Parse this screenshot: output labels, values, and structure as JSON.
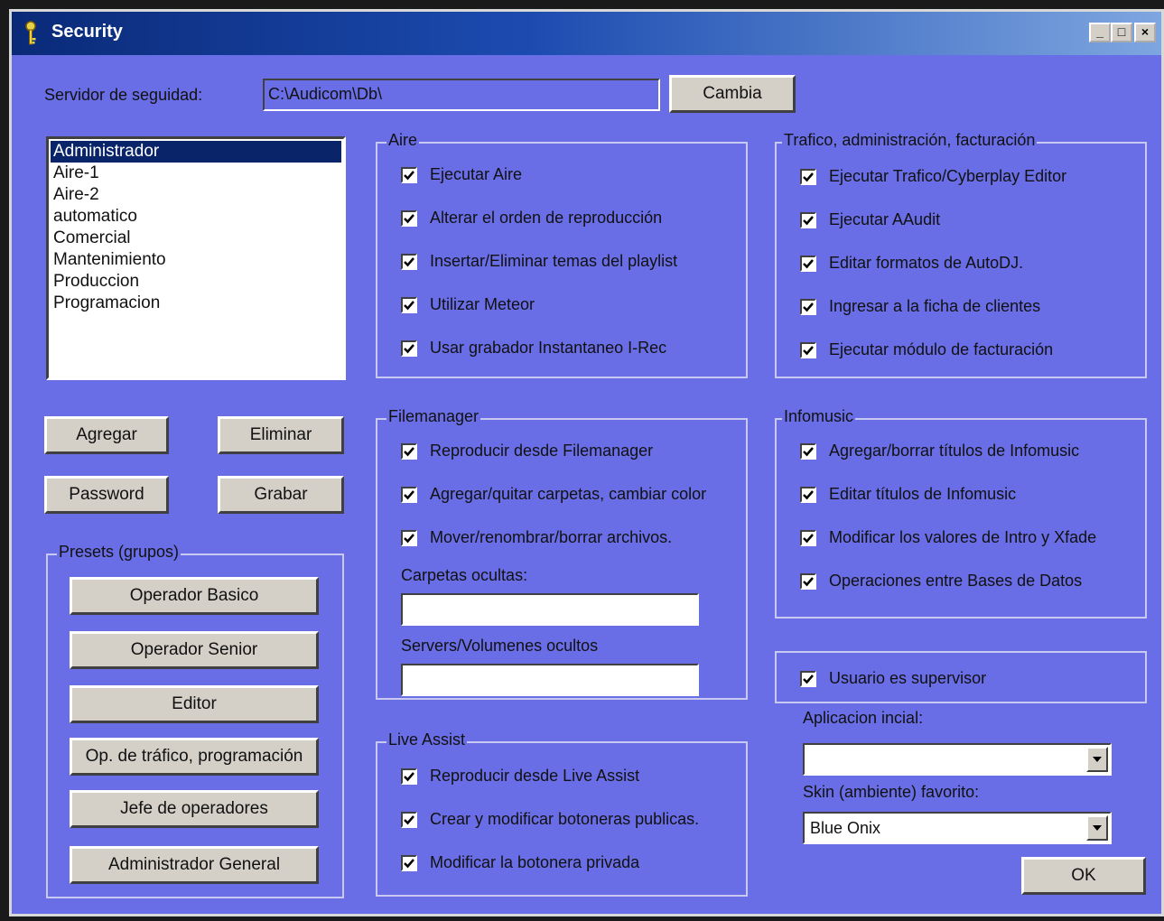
{
  "window": {
    "title": "Security",
    "minimize": "_",
    "maximize": "□",
    "close": "×"
  },
  "server": {
    "label": "Servidor de seguidad:",
    "value": "C:\\Audicom\\Db\\",
    "change_button": "Cambia"
  },
  "users": {
    "items": [
      "Administrador",
      "Aire-1",
      "Aire-2",
      "automatico",
      "Comercial",
      "Mantenimiento",
      "Produccion",
      "Programacion"
    ],
    "selected": "Administrador"
  },
  "user_buttons": {
    "add": "Agregar",
    "delete": "Eliminar",
    "password": "Password",
    "save": "Grabar"
  },
  "presets": {
    "title": "Presets (grupos)",
    "buttons": [
      "Operador Basico",
      "Operador Senior",
      "Editor",
      "Op. de tráfico, programación",
      "Jefe de operadores",
      "Administrador General"
    ]
  },
  "aire": {
    "title": "Aire",
    "items": [
      {
        "label": "Ejecutar Aire",
        "checked": true
      },
      {
        "label": "Alterar el orden de reproducción",
        "checked": true
      },
      {
        "label": "Insertar/Eliminar temas del playlist",
        "checked": true
      },
      {
        "label": "Utilizar Meteor",
        "checked": true
      },
      {
        "label": "Usar grabador Instantaneo I-Rec",
        "checked": true
      }
    ]
  },
  "filemanager": {
    "title": "Filemanager",
    "items": [
      {
        "label": "Reproducir desde Filemanager",
        "checked": true
      },
      {
        "label": "Agregar/quitar carpetas, cambiar color",
        "checked": true
      },
      {
        "label": "Mover/renombrar/borrar archivos.",
        "checked": true
      }
    ],
    "hidden_folders_label": "Carpetas ocultas:",
    "hidden_folders_value": "",
    "hidden_servers_label": "Servers/Volumenes ocultos",
    "hidden_servers_value": ""
  },
  "live_assist": {
    "title": "Live Assist",
    "items": [
      {
        "label": "Reproducir desde Live Assist",
        "checked": true
      },
      {
        "label": "Crear y modificar botoneras publicas.",
        "checked": true
      },
      {
        "label": "Modificar la botonera privada",
        "checked": true
      }
    ]
  },
  "trafico": {
    "title": "Trafico, administración, facturación",
    "items": [
      {
        "label": "Ejecutar Trafico/Cyberplay Editor",
        "checked": true
      },
      {
        "label": "Ejecutar AAudit",
        "checked": true
      },
      {
        "label": "Editar formatos de AutoDJ.",
        "checked": true
      },
      {
        "label": "Ingresar a la ficha de clientes",
        "checked": true
      },
      {
        "label": "Ejecutar módulo de facturación",
        "checked": true
      }
    ]
  },
  "infomusic": {
    "title": "Infomusic",
    "items": [
      {
        "label": "Agregar/borrar títulos de Infomusic",
        "checked": true
      },
      {
        "label": "Editar títulos de Infomusic",
        "checked": true
      },
      {
        "label": "Modificar los valores de Intro y Xfade",
        "checked": true
      },
      {
        "label": "Operaciones entre Bases de Datos",
        "checked": true
      }
    ]
  },
  "supervisor": {
    "label": "Usuario es supervisor",
    "checked": true
  },
  "initial_app": {
    "label": "Aplicacion incial:",
    "value": ""
  },
  "skin": {
    "label": "Skin (ambiente) favorito:",
    "value": "Blue Onix"
  },
  "ok_button": "OK",
  "colors": {
    "background": "#6a6ee6",
    "titlebar_start": "#0a2a78",
    "titlebar_end": "#7ea6e0",
    "button_face": "#d4d0c8",
    "selection": "#0a246a"
  },
  "icons": {
    "title": "key-icon",
    "checkmark": "checkmark-icon",
    "dropdown": "chevron-down-icon"
  }
}
